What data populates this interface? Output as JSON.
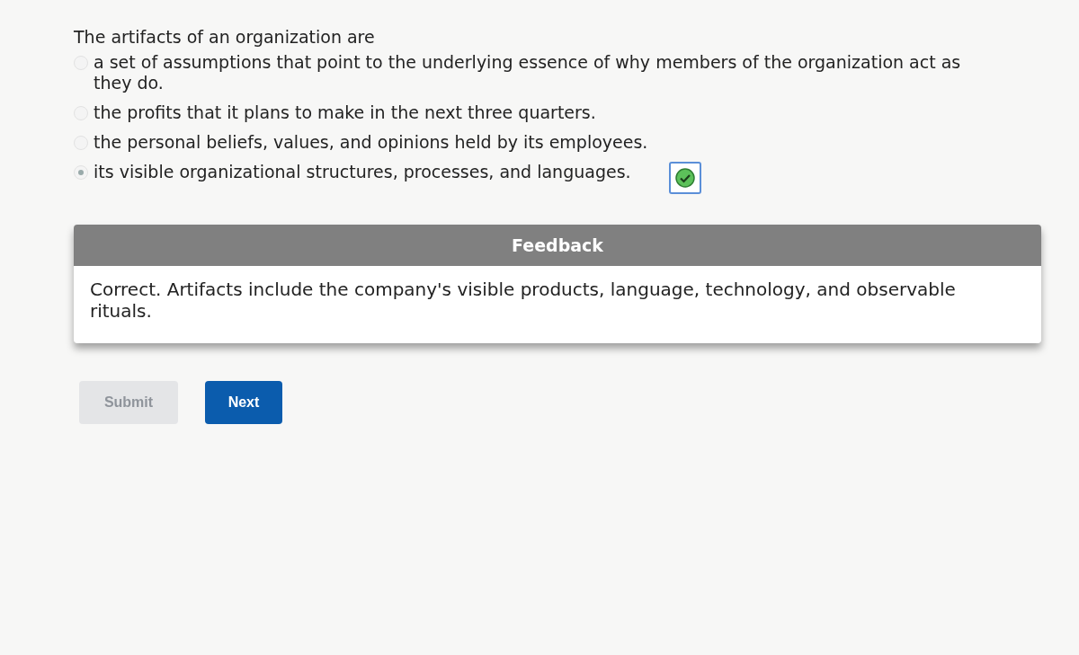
{
  "question": "The artifacts of an organization are",
  "options": [
    {
      "text": "a set of assumptions that point to the underlying essence of why members of the organization act as they do.",
      "selected": false,
      "correct": false
    },
    {
      "text": "the profits that it plans to make in the next three quarters.",
      "selected": false,
      "correct": false
    },
    {
      "text": "the personal beliefs, values, and opinions held by its employees.",
      "selected": false,
      "correct": false
    },
    {
      "text": "its visible organizational structures, processes, and languages.",
      "selected": true,
      "correct": true
    }
  ],
  "feedback": {
    "title": "Feedback",
    "text": "Correct. Artifacts include the company's visible products, language, technology, and observable rituals."
  },
  "buttons": [
    {
      "label": "Submit",
      "disabled": true
    },
    {
      "label": "Next",
      "disabled": false
    }
  ]
}
